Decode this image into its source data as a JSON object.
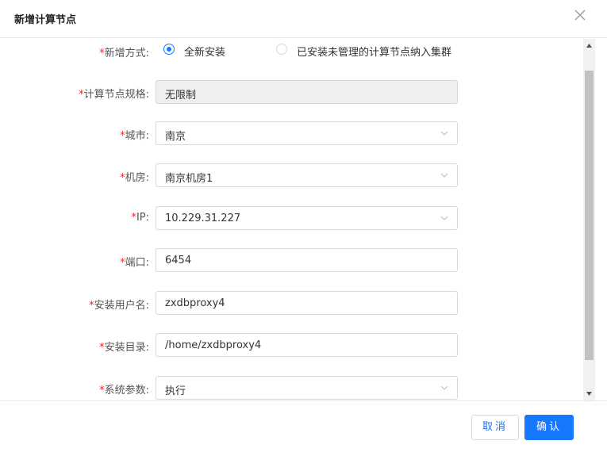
{
  "dialog": {
    "title": "新增计算节点"
  },
  "form": {
    "add_mode": {
      "label": "新增方式:",
      "options": [
        "全新安装",
        "已安装未管理的计算节点纳入集群"
      ],
      "selected": "全新安装"
    },
    "spec": {
      "label": "计算节点规格:",
      "value": "无限制"
    },
    "city": {
      "label": "城市:",
      "value": "南京"
    },
    "room": {
      "label": "机房:",
      "value": "南京机房1"
    },
    "ip": {
      "label": "IP:",
      "value": "10.229.31.227"
    },
    "port": {
      "label": "端口:",
      "value": "6454"
    },
    "install_user": {
      "label": "安装用户名:",
      "value": "zxdbproxy4"
    },
    "install_dir": {
      "label": "安装目录:",
      "value": "/home/zxdbproxy4"
    },
    "sys_params": {
      "label": "系统参数:",
      "value": "执行"
    },
    "required_mark": "*"
  },
  "footer": {
    "cancel_label": "取消",
    "ok_label": "确认"
  },
  "colors": {
    "primary": "#1677ff",
    "required": "#f5222d"
  },
  "icons": {
    "close": "close-icon",
    "dropdown": "chevron-down-icon"
  }
}
